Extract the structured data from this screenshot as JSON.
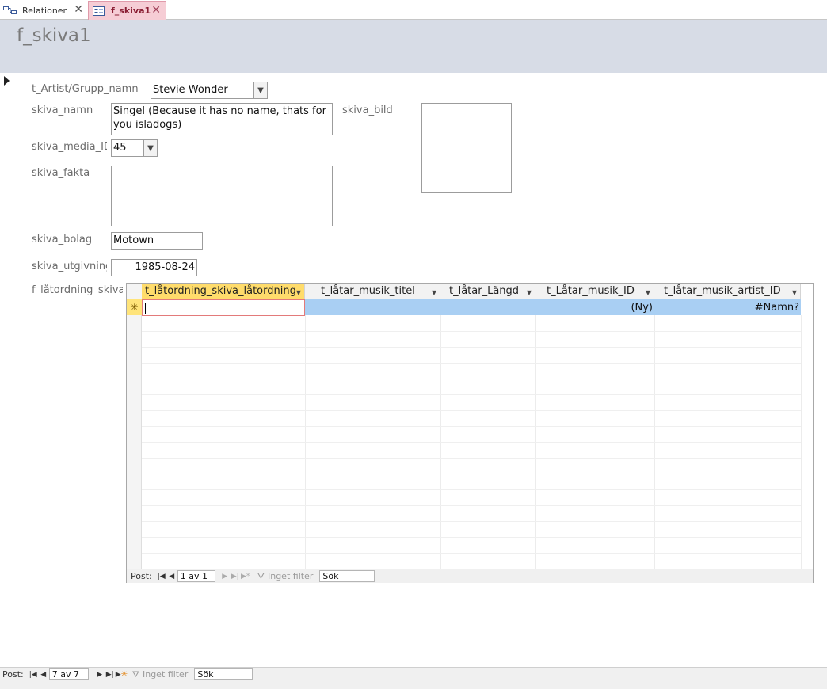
{
  "tabs": [
    {
      "label": "Relationer",
      "icon": "relationships-icon"
    },
    {
      "label": "f_skiva1",
      "icon": "form-icon",
      "active": true
    }
  ],
  "form": {
    "title": "f_skiva1",
    "fields": {
      "artist": {
        "label": "t_Artist/Grupp_namn",
        "value": "Stevie Wonder"
      },
      "skiva_namn": {
        "label": "skiva_namn",
        "value": "Singel (Because it has no name, thats for you isladogs)"
      },
      "skiva_bild": {
        "label": "skiva_bild"
      },
      "media_id": {
        "label": "skiva_media_ID",
        "value": "45"
      },
      "fakta": {
        "label": "skiva_fakta",
        "value": ""
      },
      "bolag": {
        "label": "skiva_bolag",
        "value": "Motown"
      },
      "utgivning": {
        "label": "skiva_utgivning",
        "value": "1985-08-24"
      },
      "subform": {
        "label": "f_låtordning_skiva"
      }
    }
  },
  "datasheet": {
    "columns": [
      {
        "label": "t_låtordning_skiva_låtordning"
      },
      {
        "label": "t_låtar_musik_titel"
      },
      {
        "label": "t_låtar_Längd"
      },
      {
        "label": "t_Låtar_musik_ID"
      },
      {
        "label": "t_låtar_musik_artist_ID"
      }
    ],
    "new_row": {
      "musik_id": "(Ny)",
      "artist_id": "#Namn?"
    }
  },
  "subnav": {
    "label": "Post:",
    "position": "1 av 1",
    "filter": "Inget filter",
    "search": "Sök"
  },
  "mainnav": {
    "label": "Post:",
    "position": "7 av 7",
    "filter": "Inget filter",
    "search": "Sök"
  }
}
